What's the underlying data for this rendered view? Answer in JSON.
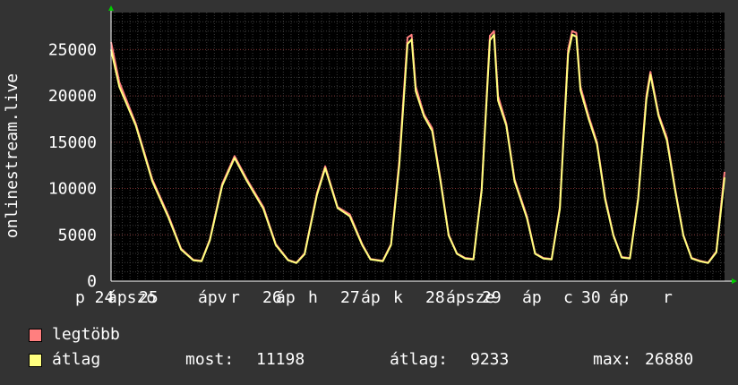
{
  "chart_data": {
    "type": "line",
    "ylabel": "onlinestream.live",
    "ylim": [
      0,
      29000
    ],
    "yticks": [
      "0",
      "5000",
      "10000",
      "15000",
      "20000",
      "25000"
    ],
    "ytick_values": [
      0,
      5000,
      10000,
      15000,
      20000,
      25000
    ],
    "xticks": [
      "p 24",
      "ápszo",
      "25",
      "ápv",
      "r",
      "26",
      "áp",
      "h",
      "27",
      "áp",
      "k",
      "28",
      "ápsze",
      "29",
      "áp",
      "c",
      "30",
      "áp",
      "r"
    ],
    "grid": true,
    "colors": {
      "background": "#333333",
      "plot": "#000000",
      "grid": "#555555",
      "max": "#ff7f7f",
      "avg": "#ffff7f"
    },
    "series": [
      {
        "name": "legtöbb",
        "color": "#ff7f7f",
        "points": [
          [
            0,
            25800
          ],
          [
            2,
            21500
          ],
          [
            6,
            17000
          ],
          [
            10,
            11000
          ],
          [
            14,
            7000
          ],
          [
            17,
            3500
          ],
          [
            20,
            2300
          ],
          [
            22,
            2200
          ],
          [
            24,
            4500
          ],
          [
            27,
            10500
          ],
          [
            30,
            13500
          ],
          [
            33,
            11000
          ],
          [
            37,
            8000
          ],
          [
            40,
            4000
          ],
          [
            43,
            2300
          ],
          [
            45,
            2000
          ],
          [
            47,
            3000
          ],
          [
            50,
            9500
          ],
          [
            52,
            12400
          ],
          [
            55,
            8000
          ],
          [
            58,
            7200
          ],
          [
            61,
            4000
          ],
          [
            63,
            2400
          ],
          [
            66,
            2200
          ],
          [
            68,
            4000
          ],
          [
            70,
            13000
          ],
          [
            72,
            26300
          ],
          [
            73,
            26600
          ],
          [
            74,
            21000
          ],
          [
            76,
            18000
          ],
          [
            78,
            16500
          ],
          [
            80,
            11000
          ],
          [
            82,
            5000
          ],
          [
            84,
            3000
          ],
          [
            86,
            2500
          ],
          [
            88,
            2400
          ],
          [
            90,
            10000
          ],
          [
            92,
            26500
          ],
          [
            93,
            27000
          ],
          [
            94,
            20000
          ],
          [
            96,
            17000
          ],
          [
            98,
            11000
          ],
          [
            101,
            7000
          ],
          [
            103,
            3000
          ],
          [
            105,
            2500
          ],
          [
            107,
            2400
          ],
          [
            109,
            8000
          ],
          [
            111,
            25000
          ],
          [
            112,
            27000
          ],
          [
            113,
            26800
          ],
          [
            114,
            21000
          ],
          [
            116,
            17800
          ],
          [
            118,
            15000
          ],
          [
            120,
            9000
          ],
          [
            122,
            5000
          ],
          [
            124,
            2600
          ],
          [
            126,
            2500
          ],
          [
            128,
            9000
          ],
          [
            130,
            20000
          ],
          [
            131,
            22600
          ],
          [
            133,
            18000
          ],
          [
            135,
            15500
          ],
          [
            137,
            10000
          ],
          [
            139,
            5000
          ],
          [
            141,
            2500
          ],
          [
            143,
            2200
          ],
          [
            145,
            2000
          ],
          [
            147,
            3200
          ],
          [
            149,
            11800
          ]
        ]
      },
      {
        "name": "átlag",
        "color": "#ffff7f",
        "points": [
          [
            0,
            25000
          ],
          [
            2,
            21000
          ],
          [
            6,
            16800
          ],
          [
            10,
            10800
          ],
          [
            14,
            6800
          ],
          [
            17,
            3400
          ],
          [
            20,
            2250
          ],
          [
            22,
            2150
          ],
          [
            24,
            4400
          ],
          [
            27,
            10300
          ],
          [
            30,
            13300
          ],
          [
            33,
            10800
          ],
          [
            37,
            7800
          ],
          [
            40,
            3900
          ],
          [
            43,
            2250
          ],
          [
            45,
            1950
          ],
          [
            47,
            2900
          ],
          [
            50,
            9300
          ],
          [
            52,
            12200
          ],
          [
            55,
            7900
          ],
          [
            58,
            7000
          ],
          [
            61,
            3900
          ],
          [
            63,
            2350
          ],
          [
            66,
            2150
          ],
          [
            68,
            3900
          ],
          [
            70,
            12500
          ],
          [
            72,
            25600
          ],
          [
            73,
            26100
          ],
          [
            74,
            20500
          ],
          [
            76,
            17800
          ],
          [
            78,
            16200
          ],
          [
            80,
            10800
          ],
          [
            82,
            4900
          ],
          [
            84,
            2950
          ],
          [
            86,
            2450
          ],
          [
            88,
            2350
          ],
          [
            90,
            9800
          ],
          [
            92,
            26000
          ],
          [
            93,
            26600
          ],
          [
            94,
            19500
          ],
          [
            96,
            16800
          ],
          [
            98,
            10800
          ],
          [
            101,
            6800
          ],
          [
            103,
            2950
          ],
          [
            105,
            2450
          ],
          [
            107,
            2350
          ],
          [
            109,
            7800
          ],
          [
            111,
            24500
          ],
          [
            112,
            26600
          ],
          [
            113,
            26400
          ],
          [
            114,
            20600
          ],
          [
            116,
            17500
          ],
          [
            118,
            14800
          ],
          [
            120,
            8800
          ],
          [
            122,
            4900
          ],
          [
            124,
            2550
          ],
          [
            126,
            2450
          ],
          [
            128,
            8800
          ],
          [
            130,
            19600
          ],
          [
            131,
            22300
          ],
          [
            133,
            17800
          ],
          [
            135,
            15200
          ],
          [
            137,
            9800
          ],
          [
            139,
            4900
          ],
          [
            141,
            2450
          ],
          [
            143,
            2150
          ],
          [
            145,
            1950
          ],
          [
            147,
            3100
          ],
          [
            149,
            11198
          ]
        ]
      }
    ]
  },
  "legend": {
    "max_label": "legtöbb",
    "avg_label": "átlag",
    "stats": {
      "most_label": "most:",
      "most_value": "11198",
      "avg_label": "átlag:",
      "avg_value": "9233",
      "max_label": "max:",
      "max_value": "26880"
    }
  }
}
